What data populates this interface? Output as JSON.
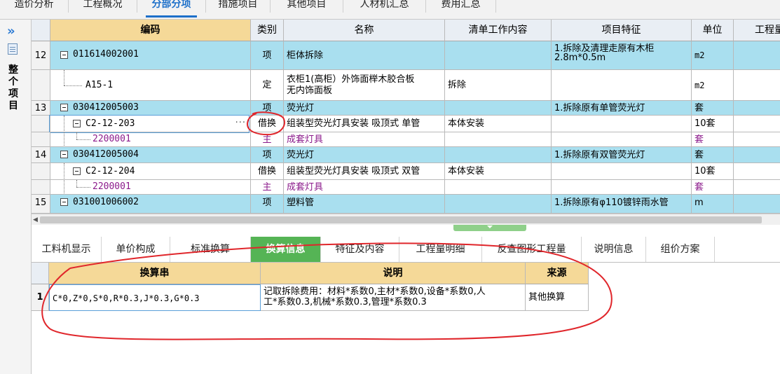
{
  "top_tabs": [
    "造价分析",
    "工程概况",
    "分部分项",
    "措施项目",
    "其他项目",
    "人材机汇总",
    "费用汇总"
  ],
  "active_top_tab": "分部分项",
  "left_strip": {
    "label": "整个项目",
    "icons": [
      "double-chevron-right-icon",
      "document-icon"
    ]
  },
  "grid": {
    "headers": [
      "编码",
      "类别",
      "名称",
      "清单工作内容",
      "项目特征",
      "单位",
      "工程量"
    ],
    "rows": [
      {
        "num": "12",
        "code": "011614002001",
        "type": "项",
        "name": "柜体拆除",
        "work": "",
        "feature": "1.拆除及清理走原有木柜\n2.8m*0.5m",
        "unit": "m2",
        "level": "list"
      },
      {
        "num": "",
        "code": "A15-1",
        "type": "定",
        "name": "衣柜1(高柜）外饰面榉木胶合板\n无内饰面板",
        "work": "拆除",
        "feature": "",
        "unit": "m2",
        "level": "quota"
      },
      {
        "num": "13",
        "code": "030412005003",
        "type": "项",
        "name": "荧光灯",
        "work": "",
        "feature": "1.拆除原有单管荧光灯",
        "unit": "套",
        "level": "list"
      },
      {
        "num": "",
        "code": "C2-12-203",
        "type": "借换",
        "name": "组装型荧光灯具安装 吸顶式 单管",
        "work": "本体安装",
        "feature": "",
        "unit": "10套",
        "level": "quota-expand"
      },
      {
        "num": "",
        "code": "2200001",
        "type": "主",
        "name": "成套灯具",
        "work": "",
        "feature": "",
        "unit": "套",
        "level": "material"
      },
      {
        "num": "14",
        "code": "030412005004",
        "type": "项",
        "name": "荧光灯",
        "work": "",
        "feature": "1.拆除原有双管荧光灯",
        "unit": "套",
        "level": "list"
      },
      {
        "num": "",
        "code": "C2-12-204",
        "type": "借换",
        "name": "组装型荧光灯具安装 吸顶式 双管",
        "work": "本体安装",
        "feature": "",
        "unit": "10套",
        "level": "quota-expand"
      },
      {
        "num": "",
        "code": "2200001",
        "type": "主",
        "name": "成套灯具",
        "work": "",
        "feature": "",
        "unit": "套",
        "level": "material"
      },
      {
        "num": "15",
        "code": "031001006002",
        "type": "项",
        "name": "塑料管",
        "work": "",
        "feature": "1.拆除原有φ110镀锌雨水管",
        "unit": "m",
        "level": "list"
      }
    ],
    "ellipsis": "···"
  },
  "lower_tabs": [
    "工料机显示",
    "单价构成",
    "标准换算",
    "换算信息",
    "特征及内容",
    "工程量明细",
    "反查图形工程量",
    "说明信息",
    "组价方案"
  ],
  "active_lower_tab": "换算信息",
  "lower_grid": {
    "headers": [
      "换算串",
      "说明",
      "来源"
    ],
    "rows": [
      {
        "num": "1",
        "string": "C*0,Z*0,S*0,R*0.3,J*0.3,G*0.3",
        "desc": "记取拆除费用：材料*系数0,主材*系数0,设备*系数0,人\n工*系数0.3,机械*系数0.3,管理*系数0.3",
        "source": "其他换算"
      }
    ]
  },
  "colors": {
    "accent": "#1c6fc9",
    "row_blue": "#a9dfef",
    "header_gold": "#f5d998",
    "tab_green": "#55b455",
    "annotation_red": "#e0262b"
  }
}
